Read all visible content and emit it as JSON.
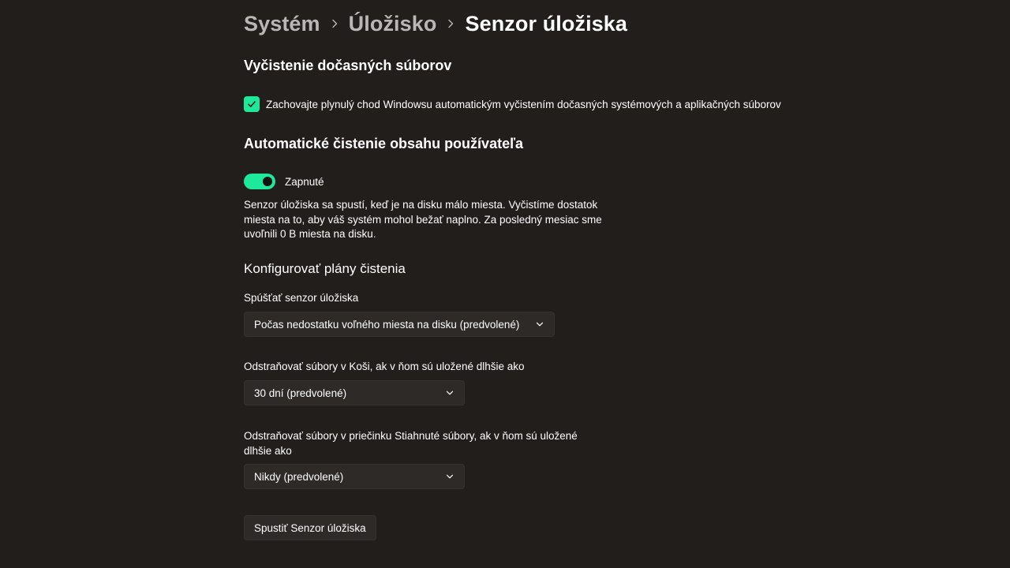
{
  "breadcrumb": {
    "items": [
      "Systém",
      "Úložisko",
      "Senzor úložiska"
    ]
  },
  "temp_files": {
    "title": "Vyčistenie dočasných súborov",
    "checkbox_label": "Zachovajte plynulý chod Windowsu automatickým vyčistením dočasných systémových a aplikačných súborov",
    "checked": true
  },
  "auto_cleanup": {
    "title": "Automatické čistenie obsahu používateľa",
    "toggle_label": "Zapnuté",
    "toggle_on": true,
    "description": "Senzor úložiska sa spustí, keď je na disku málo miesta. Vyčistíme dostatok miesta na to, aby váš systém mohol bežať naplno. Za posledný mesiac sme uvoľnili 0 B miesta na disku."
  },
  "schedules": {
    "title": "Konfigurovať plány čistenia",
    "run_label": "Spúšťať senzor úložiska",
    "run_value": "Počas nedostatku voľného miesta na disku (predvolené)",
    "recycle_label": "Odstraňovať súbory v Koši, ak v ňom sú uložené dlhšie ako",
    "recycle_value": "30 dní (predvolené)",
    "downloads_label": "Odstraňovať súbory v priečinku Stiahnuté súbory, ak v ňom sú uložené dlhšie ako",
    "downloads_value": "Nikdy (predvolené)"
  },
  "actions": {
    "run_now": "Spustiť Senzor úložiska"
  },
  "colors": {
    "background": "#221e1c",
    "accent": "#1ee89a",
    "control": "#2d2a28"
  }
}
